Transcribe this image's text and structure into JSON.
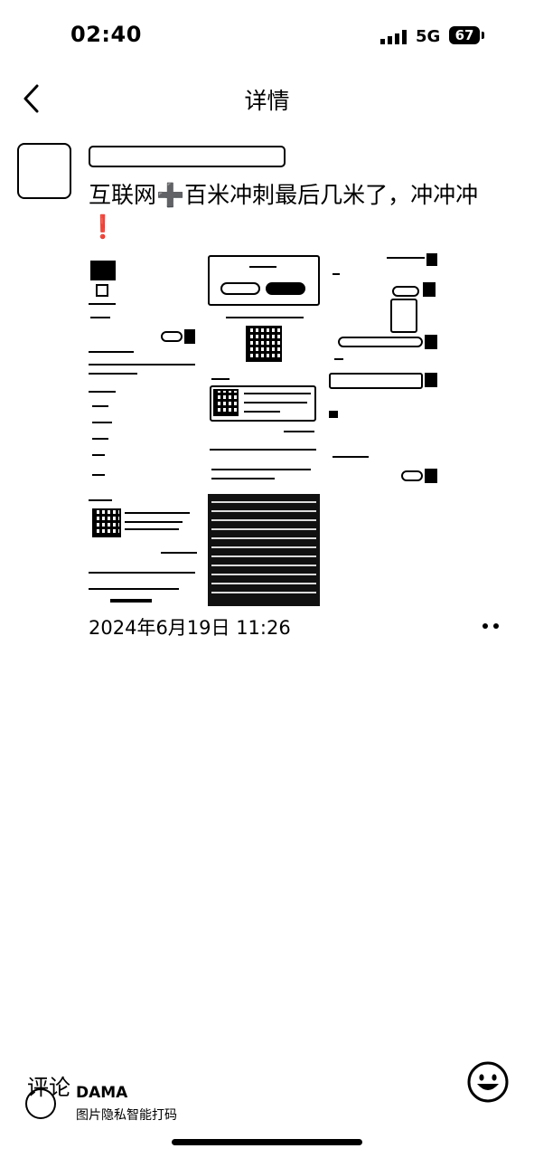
{
  "status_bar": {
    "time": "02:40",
    "network": "5G",
    "battery": "67"
  },
  "nav": {
    "title": "详情"
  },
  "post": {
    "text_before": "互联网",
    "plus_glyph": "➕",
    "text_after": "百米冲刺最后几米了，冲冲冲",
    "exclaim_glyph": "❗",
    "timestamp": "2024年6月19日 11:26"
  },
  "bottom_bar": {
    "comment_label": "评论",
    "watermark_title": "DAMA",
    "watermark_subtitle": "图片隐私智能打码"
  },
  "icons": {
    "back": "chevron-left-icon",
    "more": "more-dots-icon",
    "emoji": "smiley-icon"
  }
}
